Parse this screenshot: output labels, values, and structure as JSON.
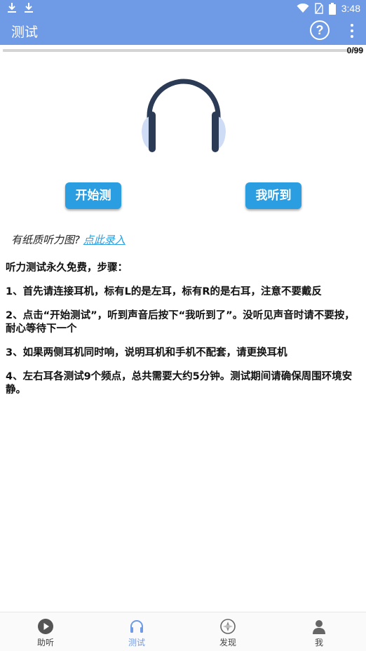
{
  "status_bar": {
    "time": "3:48"
  },
  "app_bar": {
    "title": "测试",
    "help_symbol": "?"
  },
  "progress": {
    "text": "0/99",
    "current": 0,
    "total": 99
  },
  "buttons": {
    "start": "开始测试",
    "heard": "我听到了"
  },
  "paper": {
    "prompt": "有纸质听力图?",
    "link": "点此录入"
  },
  "instructions": [
    "听力测试永久免费，步骤：",
    "1、首先请连接耳机，标有L的是左耳，标有R的是右耳，注意不要戴反",
    "2、点击“开始测试”，听到声音后按下“我听到了”。没听见声音时请不要按，耐心等待下一个",
    "3、如果两侧耳机同时响，说明耳机和手机不配套，请更换耳机",
    "4、左右耳各测试9个频点，总共需要大约5分钟。测试期间请确保周围环境安静。"
  ],
  "nav": [
    {
      "label": "助听",
      "icon": "play-circle-icon"
    },
    {
      "label": "测试",
      "icon": "headphones-icon",
      "active": true
    },
    {
      "label": "发现",
      "icon": "compass-icon"
    },
    {
      "label": "我",
      "icon": "person-icon"
    }
  ],
  "colors": {
    "primary": "#6f9be6",
    "button": "#2a9ee0",
    "headphone_dark": "#2b3a55",
    "headphone_light": "#cfdcf5"
  }
}
